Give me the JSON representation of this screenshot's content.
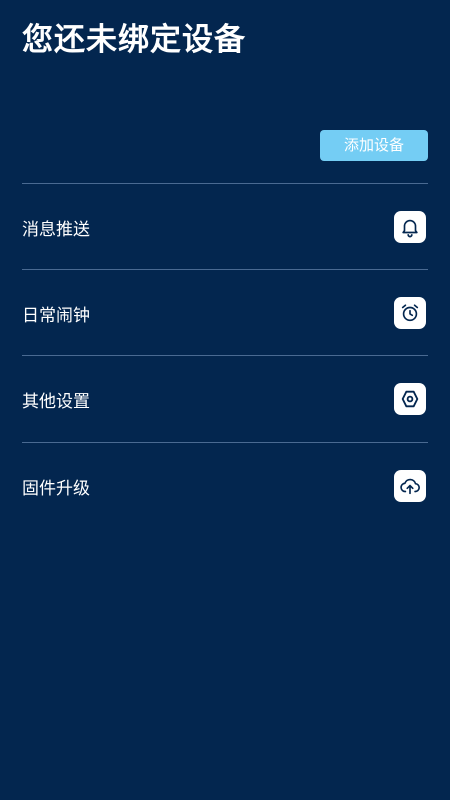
{
  "header": {
    "title": "您还未绑定设备"
  },
  "actions": {
    "add_device_label": "添加设备"
  },
  "colors": {
    "background": "#03264f",
    "accent_button": "#74cdf4",
    "divider": "#4a6a92",
    "icon_bg": "#ffffff",
    "icon_fg": "#03264f"
  },
  "menu": {
    "items": [
      {
        "label": "消息推送",
        "icon": "bell-icon"
      },
      {
        "label": "日常闹钟",
        "icon": "alarm-clock-icon"
      },
      {
        "label": "其他设置",
        "icon": "settings-hex-icon"
      },
      {
        "label": "固件升级",
        "icon": "cloud-upload-icon"
      }
    ]
  }
}
